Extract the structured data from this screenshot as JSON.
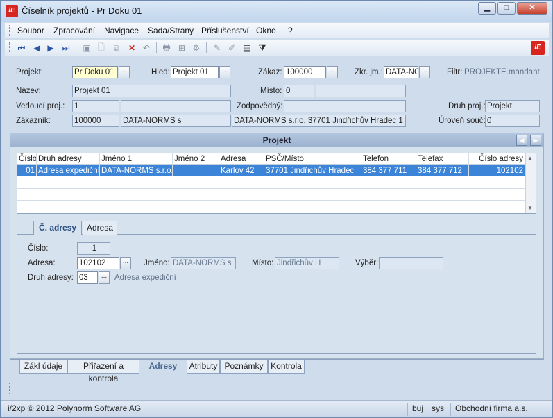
{
  "window": {
    "title": "Číselník projektů - Pr Doku 01",
    "logo_text": "iE"
  },
  "window_controls": {
    "minimize": "▁",
    "maximize": "□",
    "close": "✕"
  },
  "menu": {
    "items": [
      "Soubor",
      "Zpracování",
      "Navigace",
      "Sada/Strany",
      "Příslušenství",
      "Okno",
      "?"
    ]
  },
  "toolbar": {
    "icons": [
      "first-record-icon",
      "previous-record-icon",
      "next-record-icon",
      "last-record-icon",
      "save-icon",
      "new-icon",
      "copy-icon",
      "delete-icon",
      "undo-icon",
      "print-icon",
      "tree-icon",
      "settings-icon",
      "edit-icon",
      "pencil-icon",
      "report-icon",
      "filter-icon"
    ],
    "glyphs": {
      "first": "⏮",
      "prev": "◀",
      "next": "▶",
      "last": "⏭",
      "save": "▣",
      "new": "🗋",
      "copy": "⧉",
      "delete": "✕",
      "undo": "↶",
      "print": "🖶",
      "tree": "⊞",
      "settings": "⚙",
      "edit": "✎",
      "pencil": "✐",
      "report": "▤",
      "filter": "⧩"
    },
    "logo_text": "iE"
  },
  "header_form": {
    "projekt": {
      "label": "Projekt:",
      "value": "Pr Doku 01"
    },
    "hled": {
      "label": "Hled:",
      "value": "Projekt 01"
    },
    "zakaz": {
      "label": "Zákaz:",
      "value": "100000"
    },
    "zkr_jm": {
      "label": "Zkr. jm.:",
      "value": "DATA-NO"
    },
    "filtr": {
      "label": "Filtr:",
      "value": "PROJEKTE.mandant"
    },
    "nazev": {
      "label": "Název:",
      "value": "Projekt 01"
    },
    "misto": {
      "label": "Místo:",
      "value": "0",
      "value2": ""
    },
    "vedouci": {
      "label": "Vedoucí proj.:",
      "value": "1",
      "value2": ""
    },
    "zodpovedny": {
      "label": "Zodpovědný:",
      "value": ""
    },
    "druh_proj": {
      "label": "Druh proj.:",
      "value": "Projekt"
    },
    "zakaznik": {
      "label": "Zákazník:",
      "value": "100000",
      "name": "DATA-NORMS s",
      "address": "DATA-NORMS s.r.o. 37701 Jindřichův Hradec 1"
    },
    "uroven": {
      "label": "Úroveň souč:",
      "value": "0"
    },
    "dots": "..."
  },
  "panel": {
    "title": "Projekt",
    "nav_prev": "◀",
    "nav_next": "▶",
    "grid": {
      "columns": [
        "Číslo",
        "Druh adresy",
        "Jméno 1",
        "Jméno 2",
        "Adresa",
        "PSČ/Místo",
        "Telefon",
        "Telefax",
        "Číslo adresy"
      ],
      "rows": [
        [
          "01",
          "Adresa expediční",
          "DATA-NORMS s.r.o.",
          "",
          "Karlov 42",
          "37701 Jindřichův Hradec",
          "384 377 711",
          "384 377 712",
          "102102"
        ]
      ],
      "scroll_up": "▲",
      "scroll_down": "▼"
    },
    "tabs": [
      "Č. adresy",
      "Adresa"
    ],
    "detail": {
      "cislo": {
        "label": "Číslo:",
        "value": "1"
      },
      "adresa": {
        "label": "Adresa:",
        "value": "102102"
      },
      "jmeno": {
        "label": "Jméno:",
        "value": "DATA-NORMS s"
      },
      "misto": {
        "label": "Místo:",
        "value": "Jindřichův H"
      },
      "vyber": {
        "label": "Výběr:",
        "value": ""
      },
      "druh_adresy": {
        "label": "Druh adresy:",
        "value": "03",
        "description": "Adresa expediční"
      }
    }
  },
  "bottom_tabs": [
    "Zákl údaje",
    "Přiřazení a kontrola",
    "Adresy",
    "Atributy",
    "Poznámky",
    "Kontrola"
  ],
  "status": {
    "copyright": "i/2xp © 2012 Polynorm Software AG",
    "user": "buj",
    "system": "sys",
    "company": "Obchodní firma a.s."
  }
}
